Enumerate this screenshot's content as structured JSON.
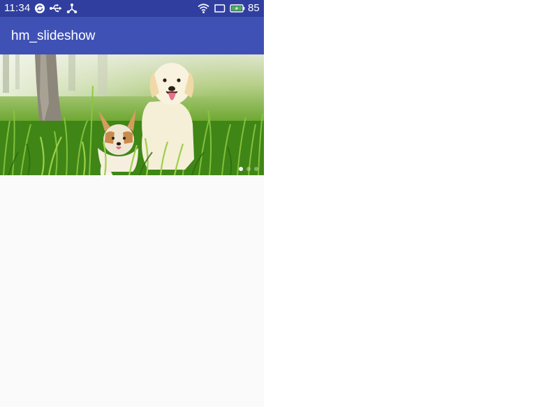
{
  "status_bar": {
    "time": "11:34",
    "battery_level": "85",
    "icons": [
      "sync-icon",
      "usb-icon",
      "share-icon",
      "wifi-icon",
      "screen-icon",
      "battery-charging-icon"
    ]
  },
  "app_bar": {
    "title": "hm_slideshow",
    "color": "#3f51b5"
  },
  "slideshow": {
    "slide_count": 3,
    "active_index": 0,
    "current_slide": "dogs-in-grass-photo"
  },
  "colors": {
    "status_bar": "#303f9f",
    "app_bar": "#3f51b5",
    "background": "#fafafa"
  }
}
